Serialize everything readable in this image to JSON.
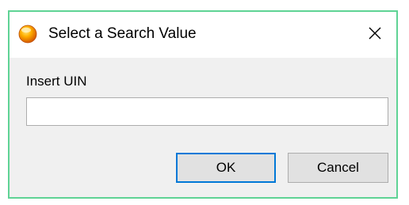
{
  "window": {
    "title": "Select a Search Value",
    "icon": "orange-orb-icon",
    "close_icon": "close-icon"
  },
  "form": {
    "label": "Insert UIN",
    "input_value": "",
    "input_placeholder": ""
  },
  "buttons": {
    "ok_label": "OK",
    "cancel_label": "Cancel"
  },
  "colors": {
    "window_border": "#5fd395",
    "default_button_border": "#0078d7",
    "dialog_background": "#f0f0f0"
  }
}
